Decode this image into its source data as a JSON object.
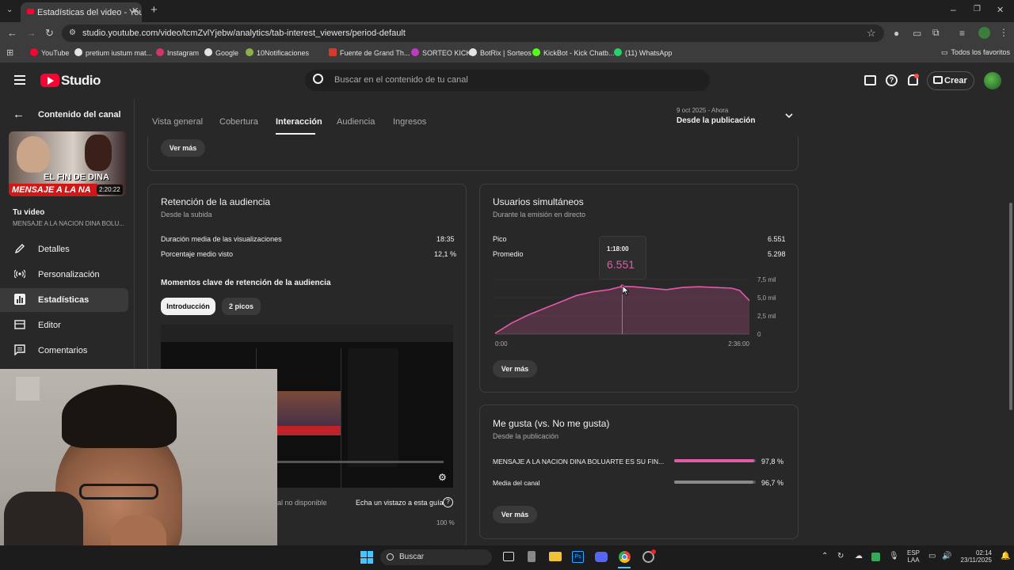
{
  "browser": {
    "tab_title": "Estadísticas del video - YouTube",
    "url": "studio.youtube.com/video/tcmZvlYjebw/analytics/tab-interest_viewers/period-default",
    "bookmarks": [
      "YouTube",
      "pretium iustum mat...",
      "Instagram",
      "Google",
      "10Notificaciones",
      "Fuente de Grand Th...",
      "SORTEO KICK",
      "BotRix | Sorteos",
      "KickBot - Kick Chatb...",
      "(11) WhatsApp"
    ],
    "all_bookmarks": "Todos los favoritos"
  },
  "header": {
    "logo_text": "Studio",
    "search_placeholder": "Buscar en el contenido de tu canal",
    "create_label": "Crear"
  },
  "sidebar": {
    "back_label": "Contenido del canal",
    "thumb_title": "EL FIN DE DINA",
    "thumb_banner": "MENSAJE A LA NA",
    "thumb_duration": "2:20:22",
    "your_video": "Tu video",
    "video_title": "MENSAJE A LA NACION DINA BOLU...",
    "items": [
      {
        "label": "Detalles"
      },
      {
        "label": "Personalización"
      },
      {
        "label": "Estadísticas"
      },
      {
        "label": "Editor"
      },
      {
        "label": "Comentarios"
      }
    ]
  },
  "tabs": [
    "Vista general",
    "Cobertura",
    "Interacción",
    "Audiencia",
    "Ingresos"
  ],
  "period": {
    "range": "9 oct 2025 - Ahora",
    "label": "Desde la publicación"
  },
  "top_card": {
    "button": "Ver más"
  },
  "retention": {
    "title": "Retención de la audiencia",
    "subtitle": "Desde la subida",
    "rows": [
      {
        "label": "Duración media de las visualizaciones",
        "value": "18:35"
      },
      {
        "label": "Porcentaje medio visto",
        "value": "12,1 %"
      }
    ],
    "moments_title": "Momentos clave de retención de la audiencia",
    "chips": [
      "Introducción",
      "2 picos"
    ],
    "unavailable": "al no disponible",
    "guide": "Echa un vistazo a esta guía",
    "pct": "100 %"
  },
  "concurrent": {
    "title": "Usuarios simultáneos",
    "subtitle": "Durante la emisión en directo",
    "peak_label": "Pico",
    "peak_value": "6.551",
    "avg_label": "Promedio",
    "avg_value": "5.298",
    "tooltip_time": "1:18:00",
    "tooltip_value": "6.551",
    "button": "Ver más",
    "line_color": "#e35aa8"
  },
  "chart_data": {
    "type": "area",
    "title": "Usuarios simultáneos",
    "x": [
      0,
      10,
      20,
      30,
      40,
      50,
      60,
      70,
      78,
      85,
      95,
      105,
      115,
      125,
      135,
      145,
      150,
      156
    ],
    "x_tick_labels": [
      "0:00",
      "2:36:00"
    ],
    "y_tick_labels": [
      "7,5 mil",
      "5,0 mil",
      "2,5 mil",
      "0"
    ],
    "ylim": [
      0,
      7500
    ],
    "values": [
      100,
      1500,
      2600,
      3500,
      4400,
      5300,
      5800,
      6100,
      6551,
      6500,
      6300,
      6100,
      6400,
      6500,
      6400,
      6300,
      6000,
      4600
    ]
  },
  "likes": {
    "title": "Me gusta (vs. No me gusta)",
    "subtitle": "Desde la publicación",
    "rows": [
      {
        "label": "MENSAJE A LA NACION DINA BOLUARTE ES SU FIN...",
        "value": "97,8 %",
        "pct": 0.978,
        "color": "#e35aa8"
      },
      {
        "label": "Media del canal",
        "value": "96,7 %",
        "pct": 0.967,
        "color": "#8a8a8a"
      }
    ],
    "button": "Ver más"
  },
  "taskbar": {
    "search": "Buscar",
    "lang1": "ESP",
    "lang2": "LAA",
    "time": "02:14",
    "date": "23/11/2025"
  }
}
